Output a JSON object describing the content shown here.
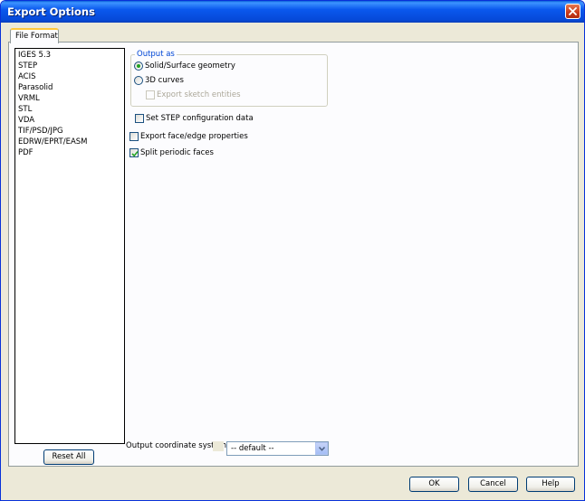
{
  "window": {
    "title": "Export Options"
  },
  "tabs": [
    {
      "label": "File Format",
      "active": true
    }
  ],
  "format_list": {
    "items": [
      {
        "label": "IGES 5.3"
      },
      {
        "label": "STEP",
        "selected": true
      },
      {
        "label": "ACIS"
      },
      {
        "label": "Parasolid"
      },
      {
        "label": "VRML"
      },
      {
        "label": "STL"
      },
      {
        "label": "VDA"
      },
      {
        "label": "TIF/PSD/JPG"
      },
      {
        "label": "EDRW/EPRT/EASM"
      },
      {
        "label": "PDF"
      }
    ]
  },
  "reset_button": {
    "label": "Reset All"
  },
  "output_as": {
    "group_label": "Output as",
    "solid_label": "Solid/Surface geometry",
    "solid_selected": true,
    "curves_label": "3D curves",
    "curves_selected": false,
    "sketch_label": "Export sketch entities",
    "sketch_enabled": false
  },
  "options": {
    "step_config_label": "Set STEP configuration data",
    "step_config_checked": false,
    "face_edge_label": "Export face/edge properties",
    "face_edge_checked": false,
    "split_periodic_label": "Split periodic faces",
    "split_periodic_checked": true
  },
  "coordinate_system": {
    "label": "Output coordinate system:",
    "value": "-- default --"
  },
  "buttons": {
    "ok": "OK",
    "cancel": "Cancel",
    "help": "Help"
  },
  "colors": {
    "title_bar": "#0a58ee",
    "dialog_bg": "#ece9d8",
    "close_button": "#c9391a",
    "group_label": "#0046d5",
    "tab_highlight": "#ffc83c",
    "checkmark": "#21a121"
  },
  "icons": {
    "close": "close-x-icon",
    "dropdown": "chevron-down-icon",
    "check": "check-icon"
  }
}
